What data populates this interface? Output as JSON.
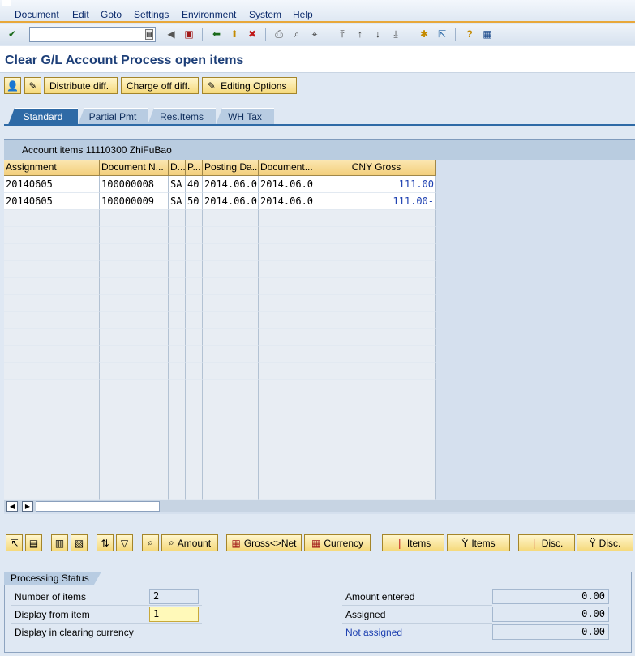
{
  "menu": [
    "Document",
    "Edit",
    "Goto",
    "Settings",
    "Environment",
    "System",
    "Help"
  ],
  "title": "Clear G/L Account Process open items",
  "app_buttons": {
    "distribute": "Distribute diff.",
    "charge_off": "Charge off diff.",
    "editing": "Editing Options"
  },
  "tabs": [
    "Standard",
    "Partial Pmt",
    "Res.Items",
    "WH Tax"
  ],
  "grid": {
    "title": "Account items 11110300 ZhiFuBao",
    "headers": [
      "Assignment",
      "Document N...",
      "D...",
      "P...",
      "Posting Da...",
      "Document...",
      "CNY Gross"
    ],
    "rows": [
      [
        "20140605",
        "100000008",
        "SA",
        "40",
        "2014.06.0",
        "2014.06.0",
        "111.00"
      ],
      [
        "20140605",
        "100000009",
        "SA",
        "50",
        "2014.06.0",
        "2014.06.0",
        "111.00-"
      ]
    ]
  },
  "bottom_buttons": {
    "amount": "Amount",
    "gross_net": "Gross<>Net",
    "currency": "Currency",
    "items1": "Items",
    "items2": "Items",
    "disc1": "Disc.",
    "disc2": "Disc."
  },
  "processing": {
    "title": "Processing Status",
    "num_items_label": "Number of items",
    "num_items": "2",
    "display_from_label": "Display from item",
    "display_from": "1",
    "display_clearing_label": "Display in clearing currency",
    "amount_entered_label": "Amount entered",
    "amount_entered": "0.00",
    "assigned_label": "Assigned",
    "assigned": "0.00",
    "not_assigned_label": "Not assigned",
    "not_assigned": "0.00"
  },
  "colors": {
    "accent": "#2e6aa6",
    "button": "#f5d97c",
    "link": "#1c3fb0"
  }
}
